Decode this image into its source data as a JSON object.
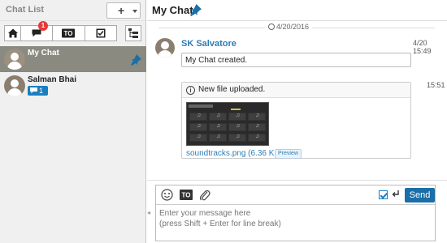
{
  "sidebar": {
    "title": "Chat List",
    "add_label": "+",
    "filter_badge": "1",
    "filters": {
      "all_icon": "home-icon",
      "unread_icon": "chat-bubble-icon",
      "to_icon": "to-icon",
      "to_label": "TO",
      "task_icon": "checkbox-icon"
    },
    "chats": [
      {
        "name": "My Chat",
        "active": true,
        "pinned": true
      },
      {
        "name": "Salman Bhai",
        "unread": "1"
      }
    ]
  },
  "main": {
    "title": "My Chat",
    "date": "4/20/2016",
    "messages": [
      {
        "sender": "SK Salvatore",
        "time": "4/20 15:49",
        "text": "My Chat created."
      },
      {
        "time": "15:51",
        "file_notice": "New file uploaded.",
        "file_link": "soundtracks.png (6.36 KB)",
        "preview_label": "Preview"
      }
    ]
  },
  "composer": {
    "placeholder": "Enter your message here\n(press Shift + Enter for line break)",
    "send_label": "Send",
    "to_label": "TO",
    "collapse_glyph": "◂"
  },
  "colors": {
    "accent": "#1a6fa8",
    "link": "#2d7db8",
    "badge": "#e53935",
    "active_row": "#8a8a80"
  }
}
